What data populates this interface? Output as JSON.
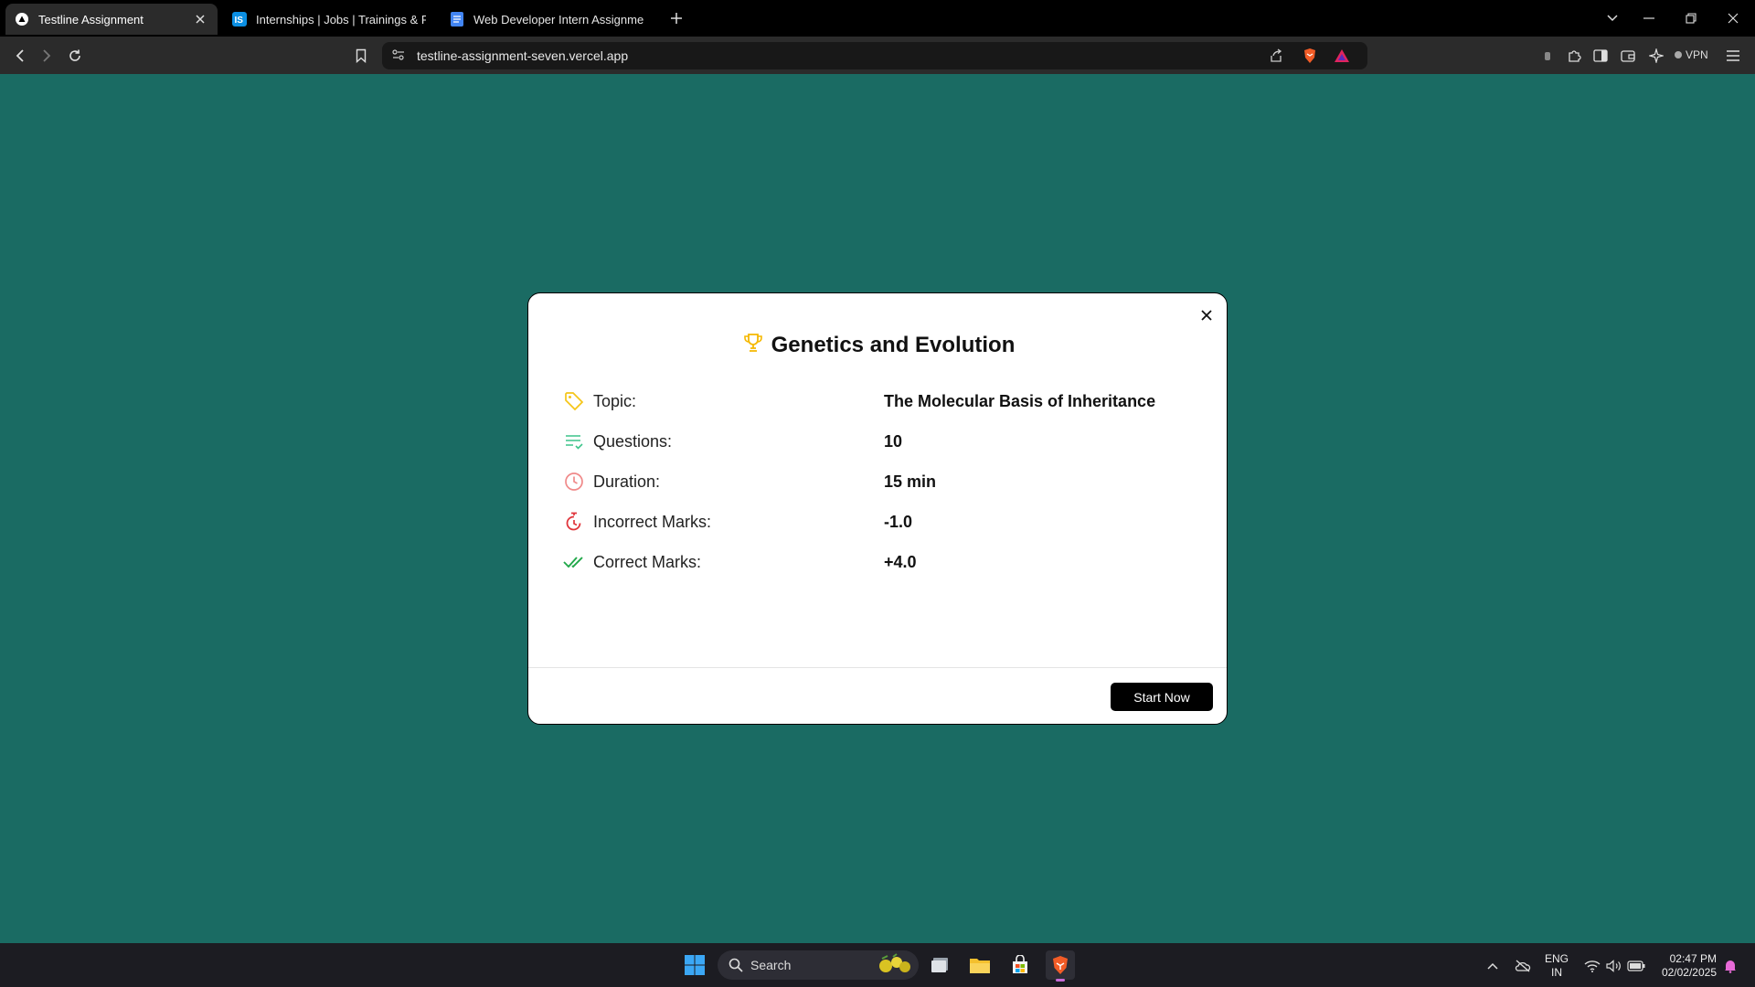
{
  "browser": {
    "tabs": [
      {
        "title": "Testline Assignment",
        "active": true
      },
      {
        "title": "Internships | Jobs | Trainings & Placements",
        "active": false
      },
      {
        "title": "Web Developer Intern Assignment",
        "active": false
      }
    ],
    "url": "testline-assignment-seven.vercel.app",
    "vpn_label": "VPN"
  },
  "modal": {
    "title": "Genetics and Evolution",
    "rows": [
      {
        "label": "Topic:",
        "value": "The Molecular Basis of Inheritance",
        "icon": "tag-icon"
      },
      {
        "label": "Questions:",
        "value": "10",
        "icon": "list-check-icon"
      },
      {
        "label": "Duration:",
        "value": "15 min",
        "icon": "clock-icon"
      },
      {
        "label": "Incorrect Marks:",
        "value": "-1.0",
        "icon": "timer-icon"
      },
      {
        "label": "Correct Marks:",
        "value": "+4.0",
        "icon": "double-check-icon"
      }
    ],
    "start_button": "Start Now"
  },
  "taskbar": {
    "search_placeholder": "Search",
    "lang_line1": "ENG",
    "lang_line2": "IN",
    "time": "02:47 PM",
    "date": "02/02/2025"
  },
  "colors": {
    "page_background": "#1a6b63",
    "trophy": "#f5b800",
    "tag": "#f5c518",
    "questions": "#3cc48a",
    "duration": "#f08a8a",
    "incorrect": "#e0353b",
    "correct": "#22a84a",
    "button": "#000000"
  }
}
